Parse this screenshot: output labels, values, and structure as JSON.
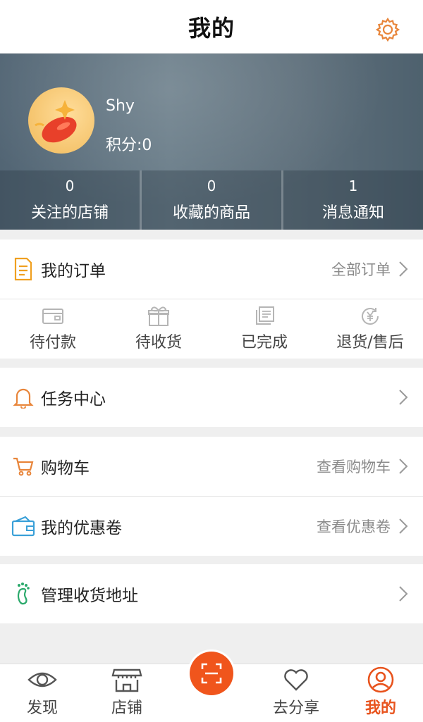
{
  "header": {
    "title": "我的",
    "settings_icon": "gear-icon"
  },
  "profile": {
    "username": "Shy",
    "points_label": "积分:",
    "points_value": "0",
    "stats": [
      {
        "count": "0",
        "label": "关注的店铺"
      },
      {
        "count": "0",
        "label": "收藏的商品"
      },
      {
        "count": "1",
        "label": "消息通知"
      }
    ]
  },
  "orders": {
    "title": "我的订单",
    "all_label": "全部订单",
    "statuses": [
      {
        "label": "待付款",
        "icon": "wallet-card-icon"
      },
      {
        "label": "待收货",
        "icon": "gift-box-icon"
      },
      {
        "label": "已完成",
        "icon": "document-stack-icon"
      },
      {
        "label": "退货/售后",
        "icon": "refund-yen-icon"
      }
    ]
  },
  "task_center": {
    "title": "任务中心"
  },
  "cart": {
    "title": "购物车",
    "more_label": "查看购物车"
  },
  "coupons": {
    "title": "我的优惠卷",
    "more_label": "查看优惠卷"
  },
  "address": {
    "title": "管理收货地址"
  },
  "tabs": [
    {
      "label": "发现",
      "icon": "eye-icon",
      "active": false
    },
    {
      "label": "店铺",
      "icon": "store-icon",
      "active": false
    },
    {
      "label": "",
      "icon": "scan-icon",
      "active": false
    },
    {
      "label": "去分享",
      "icon": "heart-icon",
      "active": false
    },
    {
      "label": "我的",
      "icon": "user-circle-icon",
      "active": true
    }
  ],
  "colors": {
    "accent": "#f0551c",
    "icon_orange": "#e8853a",
    "icon_blue": "#3aa0d8",
    "icon_green": "#2aa96b"
  }
}
